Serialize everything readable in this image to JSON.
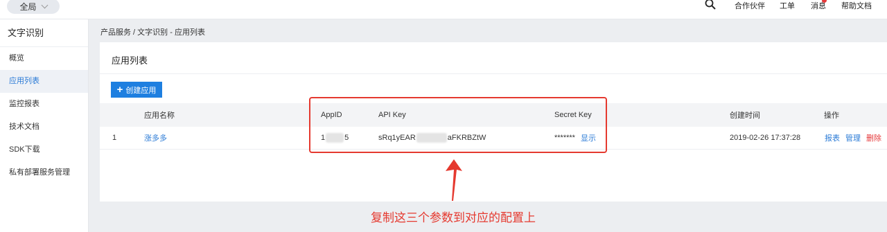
{
  "topbar": {
    "scope_label": "全局",
    "nav": [
      "合作伙伴",
      "工单",
      "消息",
      "帮助文档"
    ]
  },
  "sidebar": {
    "title": "文字识别",
    "items": [
      "概览",
      "应用列表",
      "监控报表",
      "技术文档",
      "SDK下载",
      "私有部署服务管理"
    ],
    "active_index": 1
  },
  "breadcrumb": "产品服务 / 文字识别 - 应用列表",
  "card": {
    "title": "应用列表",
    "create_button": "创建应用"
  },
  "table": {
    "columns": [
      "应用名称",
      "AppID",
      "API Key",
      "Secret Key",
      "创建时间",
      "操作"
    ],
    "rows": [
      {
        "index": "1",
        "name": "涨多多",
        "appid_prefix": "1",
        "appid_suffix": "5",
        "apikey_prefix": "sRq1yEAR",
        "apikey_suffix": "aFKRBZtW",
        "secret_mask": "*******",
        "secret_show": "显示",
        "created": "2019-02-26 17:37:28",
        "actions": [
          "报表",
          "管理",
          "删除"
        ]
      }
    ]
  },
  "annotation": {
    "text": "复制这三个参数到对应的配置上",
    "color": "#e5392f"
  },
  "colors": {
    "accent": "#1e7fe0",
    "link": "#2b7bd6",
    "danger": "#e5393b"
  }
}
